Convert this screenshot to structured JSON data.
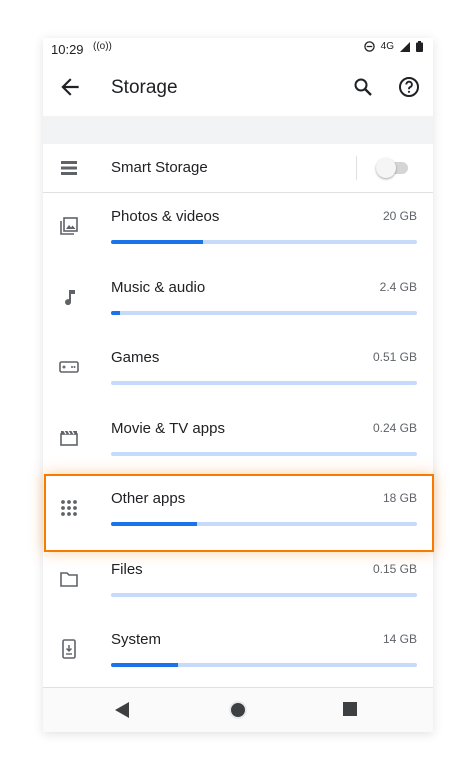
{
  "status_bar": {
    "time": "10:29",
    "network": "4G"
  },
  "app_bar": {
    "title": "Storage",
    "back_icon": "arrow-back-icon",
    "search_icon": "search-icon",
    "help_icon": "help-icon"
  },
  "smart_storage": {
    "label": "Smart Storage",
    "enabled": false
  },
  "items": [
    {
      "label": "Photos & videos",
      "size": "20 GB",
      "fraction": 0.3,
      "icon": "photo-icon"
    },
    {
      "label": "Music & audio",
      "size": "2.4 GB",
      "fraction": 0.03,
      "icon": "music-note-icon"
    },
    {
      "label": "Games",
      "size": "0.51 GB",
      "fraction": 0.0,
      "icon": "gamepad-icon"
    },
    {
      "label": "Movie & TV apps",
      "size": "0.24 GB",
      "fraction": 0.0,
      "icon": "movie-icon"
    },
    {
      "label": "Other apps",
      "size": "18 GB",
      "fraction": 0.28,
      "icon": "apps-grid-icon",
      "highlighted": true
    },
    {
      "label": "Files",
      "size": "0.15 GB",
      "fraction": 0.0,
      "icon": "folder-icon"
    },
    {
      "label": "System",
      "size": "14 GB",
      "fraction": 0.22,
      "icon": "system-update-icon"
    }
  ],
  "colors": {
    "accent": "#1a73e8",
    "bar_track": "#c6dafc",
    "highlight": "#f57c00"
  }
}
